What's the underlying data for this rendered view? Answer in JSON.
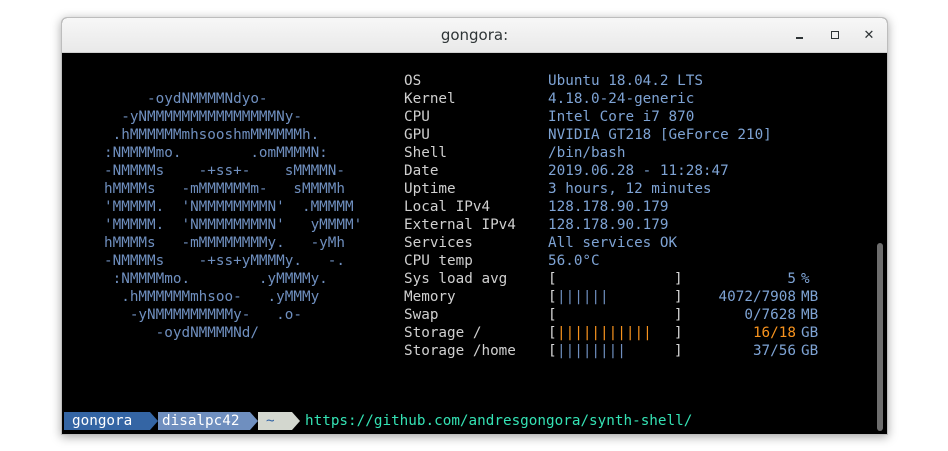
{
  "window": {
    "title": "gongora:",
    "controls": {
      "minimize": "minimize-icon",
      "maximize": "maximize-icon",
      "close": "close-icon"
    }
  },
  "logo_lines": [
    "     -oydNMMMMNdyo-",
    "  -yNMMMMMMMMMMMMMMMNy-",
    " .hMMMMMMmhsooshmMMMMMMh.",
    ":NMMMMmo.        .omMMMMN:",
    "-NMMMMs    -+ss+-    sMMMMN-",
    "hMMMMs   -mMMMMMMm-   sMMMMh",
    "'MMMMM.  'NMMMMMMMMN'  .MMMMM",
    "'MMMMM.  'NMMMMMMMMN'   yMMMM'",
    "hMMMMs   -mMMMMMMMMy.   -yMh",
    "-NMMMMs    -+ss+yMMMMy.   -.",
    " :NMMMMmo.        .yMMMMy.",
    "  .hMMMMMMmhsoo-   .yMMMy",
    "   -yNMMMMMMMMMy-   .o-",
    "      -oydNMMMMNd/"
  ],
  "info": [
    {
      "label": "OS",
      "value": "Ubuntu 18.04.2 LTS"
    },
    {
      "label": "Kernel",
      "value": "4.18.0-24-generic"
    },
    {
      "label": "CPU",
      "value": "Intel Core i7 870"
    },
    {
      "label": "GPU",
      "value": "NVIDIA GT218 [GeForce 210]"
    },
    {
      "label": "Shell",
      "value": "/bin/bash"
    },
    {
      "label": "Date",
      "value": "2019.06.28 - 11:28:47"
    },
    {
      "label": "Uptime",
      "value": "3 hours, 12 minutes"
    },
    {
      "label": "Local IPv4",
      "value": "128.178.90.179"
    },
    {
      "label": "External IPv4",
      "value": "128.178.90.179"
    },
    {
      "label": "Services",
      "value": "All services OK"
    },
    {
      "label": "CPU temp",
      "value": "56.0°C"
    }
  ],
  "meters": [
    {
      "label": "Sys load avg",
      "bar": "",
      "bar_color": "#6f8fbf",
      "value_text": "5",
      "total_text": "",
      "unit": "%",
      "warn": false,
      "fraction": 0.05
    },
    {
      "label": "Memory",
      "bar": "||||||",
      "bar_color": "#6f8fbf",
      "value_text": "4072/7908",
      "total_text": "",
      "unit": "MB",
      "warn": false,
      "fraction": 0.515
    },
    {
      "label": "Swap",
      "bar": "",
      "bar_color": "#6f8fbf",
      "value_text": "0/7628",
      "total_text": "",
      "unit": "MB",
      "warn": false,
      "fraction": 0.0
    },
    {
      "label": "Storage /",
      "bar": "|||||||||||",
      "bar_color": "#f7931e",
      "value_text": "16",
      "total_text": "/18",
      "unit": "GB",
      "warn": true,
      "fraction": 0.889
    },
    {
      "label": "Storage /home",
      "bar": "||||||||",
      "bar_color": "#6f8fbf",
      "value_text": "37/56",
      "total_text": "",
      "unit": "GB",
      "warn": false,
      "fraction": 0.66
    }
  ],
  "prompt": {
    "user": "gongora",
    "host": "disalpc42",
    "dir": "~",
    "command": "https://github.com/andresgongora/synth-shell/"
  },
  "colors": {
    "accent_blue": "#6f8fbf",
    "value_blue": "#7ea3d4",
    "warn_orange": "#f7931e",
    "command_green": "#34e2b4"
  }
}
